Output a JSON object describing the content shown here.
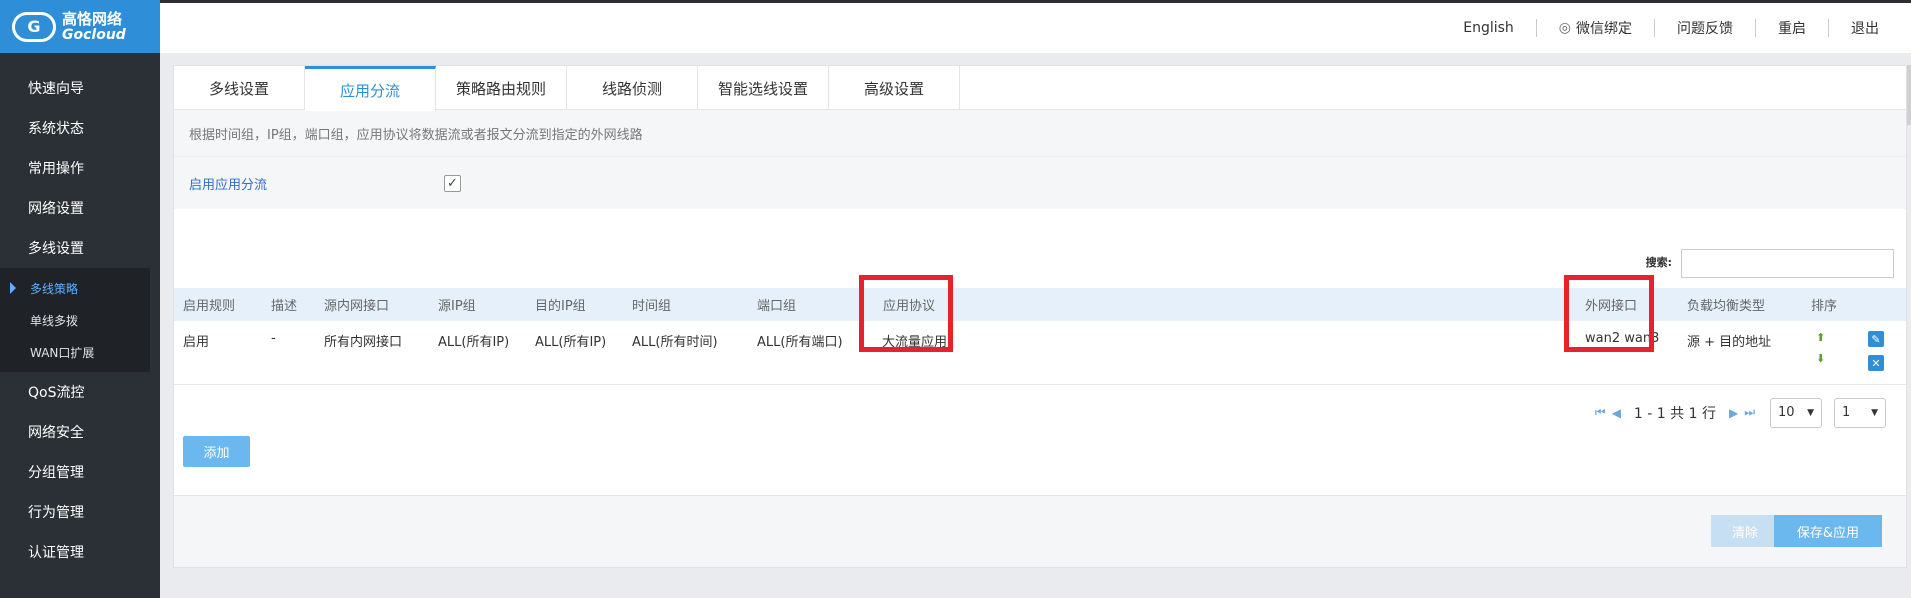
{
  "logo": {
    "cn": "高恪网络",
    "en": "Gocloud",
    "mark": "G"
  },
  "topbar": {
    "english": "English",
    "wechat": "微信绑定",
    "feedback": "问题反馈",
    "restart": "重启",
    "logout": "退出"
  },
  "sidebar": {
    "items": [
      "快速向导",
      "系统状态",
      "常用操作",
      "网络设置",
      "多线设置"
    ],
    "sub_items": [
      "多线策略",
      "单线多拨",
      "WAN口扩展"
    ],
    "items_after": [
      "QoS流控",
      "网络安全",
      "分组管理",
      "行为管理",
      "认证管理"
    ]
  },
  "tabs": [
    "多线设置",
    "应用分流",
    "策略路由规则",
    "线路侦测",
    "智能选线设置",
    "高级设置"
  ],
  "description": "根据时间组，IP组，端口组，应用协议将数据流或者报文分流到指定的外网线路",
  "enable": {
    "label": "启用应用分流",
    "checked": "✓"
  },
  "search": {
    "label": "搜索:"
  },
  "table": {
    "headers": [
      "启用规则",
      "描述",
      "源内网接口",
      "源IP组",
      "目的IP组",
      "时间组",
      "端口组",
      "应用协议",
      "外网接口",
      "负载均衡类型",
      "排序"
    ],
    "row": [
      "启用",
      "-",
      "所有内网接口",
      "ALL(所有IP)",
      "ALL(所有IP)",
      "ALL(所有时间)",
      "ALL(所有端口)",
      "大流量应用",
      "wan2 wan3",
      "源 + 目的地址"
    ]
  },
  "pager": {
    "text": "1 - 1 共 1 行",
    "page_size": "10",
    "page": "1"
  },
  "buttons": {
    "add": "添加",
    "clear": "清除",
    "save": "保存&应用"
  },
  "colors": {
    "accent": "#2e8fd8",
    "highlight": "#e8222b",
    "sidebar": "#2b3036"
  }
}
